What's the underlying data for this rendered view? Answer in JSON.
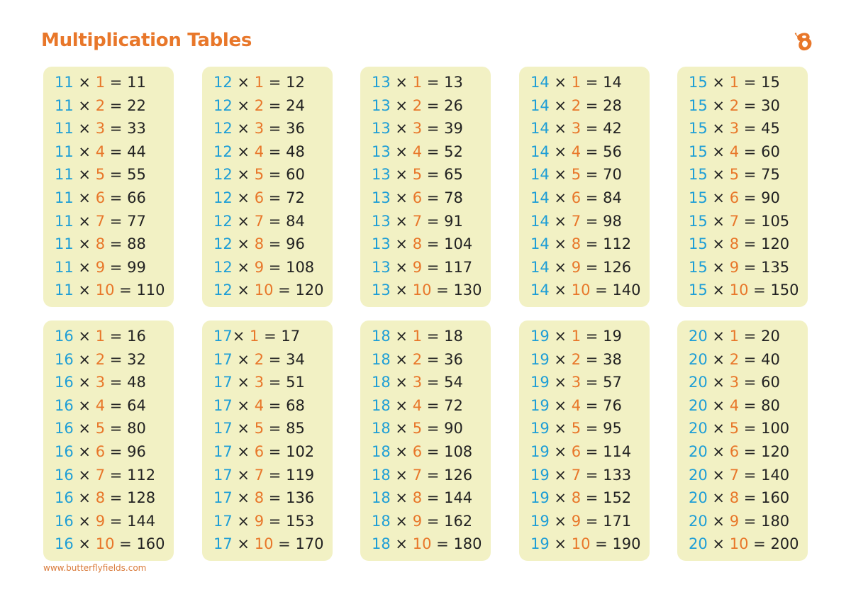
{
  "page": {
    "title": "Multiplication Tables",
    "footer": "www.butterflyfields.com",
    "logo_icon": "butterfly-logo-icon",
    "colors": {
      "title": "#e8772a",
      "multiplicand": "#1e9ed6",
      "multiplier": "#e8772a",
      "result": "#222222",
      "card_background": "#f2f1c4"
    }
  },
  "tables": [
    {
      "base": "11",
      "rows": [
        [
          "11",
          "1",
          "11"
        ],
        [
          "11",
          "2",
          "22"
        ],
        [
          "11",
          "3",
          "33"
        ],
        [
          "11",
          "4",
          "44"
        ],
        [
          "11",
          "5",
          "55"
        ],
        [
          "11",
          "6",
          "66"
        ],
        [
          "11",
          "7",
          "77"
        ],
        [
          "11",
          "8",
          "88"
        ],
        [
          "11",
          "9",
          "99"
        ],
        [
          "11",
          "10",
          "110"
        ]
      ]
    },
    {
      "base": "12",
      "rows": [
        [
          "12",
          "1",
          "12"
        ],
        [
          "12",
          "2",
          "24"
        ],
        [
          "12",
          "3",
          "36"
        ],
        [
          "12",
          "4",
          "48"
        ],
        [
          "12",
          "5",
          "60"
        ],
        [
          "12",
          "6",
          "72"
        ],
        [
          "12",
          "7",
          "84"
        ],
        [
          "12",
          "8",
          "96"
        ],
        [
          "12",
          "9",
          "108"
        ],
        [
          "12",
          "10",
          "120"
        ]
      ]
    },
    {
      "base": "13",
      "rows": [
        [
          "13",
          "1",
          "13"
        ],
        [
          "13",
          "2",
          "26"
        ],
        [
          "13",
          "3",
          "39"
        ],
        [
          "13",
          "4",
          "52"
        ],
        [
          "13",
          "5",
          "65"
        ],
        [
          "13",
          "6",
          "78"
        ],
        [
          "13",
          "7",
          "91"
        ],
        [
          "13",
          "8",
          "104"
        ],
        [
          "13",
          "9",
          "117"
        ],
        [
          "13",
          "10",
          "130"
        ]
      ]
    },
    {
      "base": "14",
      "rows": [
        [
          "14",
          "1",
          "14"
        ],
        [
          "14",
          "2",
          "28"
        ],
        [
          "14",
          "3",
          "42"
        ],
        [
          "14",
          "4",
          "56"
        ],
        [
          "14",
          "5",
          "70"
        ],
        [
          "14",
          "6",
          "84"
        ],
        [
          "14",
          "7",
          "98"
        ],
        [
          "14",
          "8",
          "112"
        ],
        [
          "14",
          "9",
          "126"
        ],
        [
          "14",
          "10",
          "140"
        ]
      ]
    },
    {
      "base": "15",
      "rows": [
        [
          "15",
          "1",
          "15"
        ],
        [
          "15",
          "2",
          "30"
        ],
        [
          "15",
          "3",
          "45"
        ],
        [
          "15",
          "4",
          "60"
        ],
        [
          "15",
          "5",
          "75"
        ],
        [
          "15",
          "6",
          "90"
        ],
        [
          "15",
          "7",
          "105"
        ],
        [
          "15",
          "8",
          "120"
        ],
        [
          "15",
          "9",
          "135"
        ],
        [
          "15",
          "10",
          "150"
        ]
      ]
    },
    {
      "base": "16",
      "rows": [
        [
          "16",
          "1",
          "16"
        ],
        [
          "16",
          "2",
          "32"
        ],
        [
          "16",
          "3",
          "48"
        ],
        [
          "16",
          "4",
          "64"
        ],
        [
          "16",
          "5",
          "80"
        ],
        [
          "16",
          "6",
          "96"
        ],
        [
          "16",
          "7",
          "112"
        ],
        [
          "16",
          "8",
          "128"
        ],
        [
          "16",
          "9",
          "144"
        ],
        [
          "16",
          "10",
          "160"
        ]
      ]
    },
    {
      "base": "17",
      "rows": [
        [
          "17",
          "1",
          "17"
        ],
        [
          "17",
          "2",
          "34"
        ],
        [
          "17",
          "3",
          "51"
        ],
        [
          "17",
          "4",
          "68"
        ],
        [
          "17",
          "5",
          "85"
        ],
        [
          "17",
          "6",
          "102"
        ],
        [
          "17",
          "7",
          "119"
        ],
        [
          "17",
          "8",
          "136"
        ],
        [
          "17",
          "9",
          "153"
        ],
        [
          "17",
          "10",
          "170"
        ]
      ]
    },
    {
      "base": "18",
      "rows": [
        [
          "18",
          "1",
          "18"
        ],
        [
          "18",
          "2",
          "36"
        ],
        [
          "18",
          "3",
          "54"
        ],
        [
          "18",
          "4",
          "72"
        ],
        [
          "18",
          "5",
          "90"
        ],
        [
          "18",
          "6",
          "108"
        ],
        [
          "18",
          "7",
          "126"
        ],
        [
          "18",
          "8",
          "144"
        ],
        [
          "18",
          "9",
          "162"
        ],
        [
          "18",
          "10",
          "180"
        ]
      ]
    },
    {
      "base": "19",
      "rows": [
        [
          "19",
          "1",
          "19"
        ],
        [
          "19",
          "2",
          "38"
        ],
        [
          "19",
          "3",
          "57"
        ],
        [
          "19",
          "4",
          "76"
        ],
        [
          "19",
          "5",
          "95"
        ],
        [
          "19",
          "6",
          "114"
        ],
        [
          "19",
          "7",
          "133"
        ],
        [
          "19",
          "8",
          "152"
        ],
        [
          "19",
          "9",
          "171"
        ],
        [
          "19",
          "10",
          "190"
        ]
      ]
    },
    {
      "base": "20",
      "rows": [
        [
          "20",
          "1",
          "20"
        ],
        [
          "20",
          "2",
          "40"
        ],
        [
          "20",
          "3",
          "60"
        ],
        [
          "20",
          "4",
          "80"
        ],
        [
          "20",
          "5",
          "100"
        ],
        [
          "20",
          "6",
          "120"
        ],
        [
          "20",
          "7",
          "140"
        ],
        [
          "20",
          "8",
          "160"
        ],
        [
          "20",
          "9",
          "180"
        ],
        [
          "20",
          "10",
          "200"
        ]
      ]
    }
  ],
  "symbols": {
    "times": "×",
    "equals": "="
  }
}
